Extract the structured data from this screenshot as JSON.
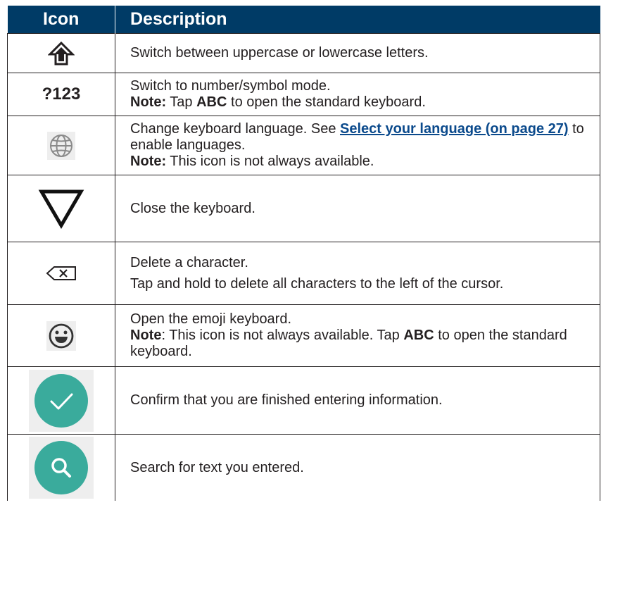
{
  "table": {
    "headers": {
      "icon": "Icon",
      "description": "Description"
    },
    "rows": [
      {
        "icon": "shift-arrow-icon",
        "line1": "Switch between uppercase or lowercase letters."
      },
      {
        "icon_text": "?123",
        "line1": "Switch to number/symbol mode.",
        "note_label": "Note:",
        "note_pre": " Tap ",
        "note_bold": "ABC",
        "note_post": " to open the standard keyboard."
      },
      {
        "icon": "globe-icon",
        "line1_pre": "Change keyboard language. See ",
        "line1_link": "Select your language (on page 27)",
        "line1_post": " to enable languages.",
        "note_label": "Note:",
        "note_text": " This icon is not always available."
      },
      {
        "icon": "down-triangle-icon",
        "line1": "Close the keyboard."
      },
      {
        "icon": "backspace-icon",
        "line1": "Delete a character.",
        "line2": "Tap and hold to delete all characters to the left of the cursor."
      },
      {
        "icon": "emoji-face-icon",
        "line1": "Open the emoji keyboard.",
        "note_label": "Note",
        "note_pre": ": This icon is not always available. Tap ",
        "note_bold": "ABC",
        "note_post": " to open the standard keyboard."
      },
      {
        "icon": "checkmark-icon",
        "line1": "Confirm that you are finished entering information."
      },
      {
        "icon": "search-icon",
        "line1": "Search for text you entered."
      }
    ]
  },
  "colors": {
    "header_bg": "#003b66",
    "accent_teal": "#3aab9c",
    "link": "#0b4a8c"
  }
}
